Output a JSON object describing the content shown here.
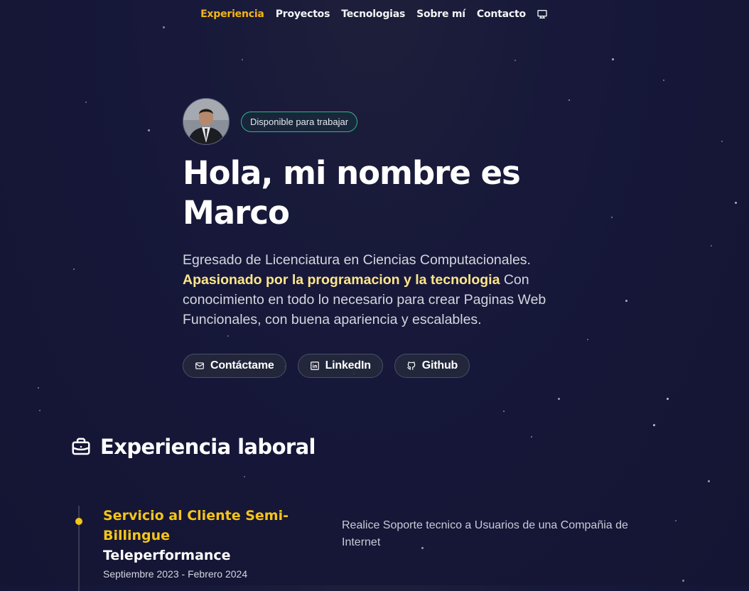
{
  "nav": {
    "items": [
      {
        "label": "Experiencia",
        "active": true
      },
      {
        "label": "Proyectos",
        "active": false
      },
      {
        "label": "Tecnologias",
        "active": false
      },
      {
        "label": "Sobre mí",
        "active": false
      },
      {
        "label": "Contacto",
        "active": false
      }
    ],
    "theme_icon": "monitor-icon"
  },
  "hero": {
    "badge": "Disponible para trabajar",
    "title": "Hola, mi nombre es Marco",
    "desc_before": "Egresado de Licenciatura en Ciencias Computacionales. ",
    "desc_highlight": "Apasionado por la programacion y la tecnologia",
    "desc_after": " Con conocimiento en todo lo necesario para crear Paginas Web Funcionales, con buena apariencia y escalables.",
    "buttons": [
      {
        "label": "Contáctame",
        "icon": "mail-icon"
      },
      {
        "label": "LinkedIn",
        "icon": "linkedin-icon"
      },
      {
        "label": "Github",
        "icon": "github-icon"
      }
    ]
  },
  "experience": {
    "title": "Experiencia laboral",
    "icon": "briefcase-icon",
    "jobs": [
      {
        "title": "Servicio al Cliente Semi-Billingue",
        "company": "Teleperformance",
        "dates": "Septiembre 2023 - Febrero 2024",
        "description": "Realice Soporte tecnico a Usuarios de una Compañia de Internet"
      }
    ]
  },
  "colors": {
    "accent": "#f5c518",
    "nav_active": "#f5b514",
    "badge_border": "#2fb58a",
    "highlight": "#fde68a",
    "background": "#16173a"
  }
}
